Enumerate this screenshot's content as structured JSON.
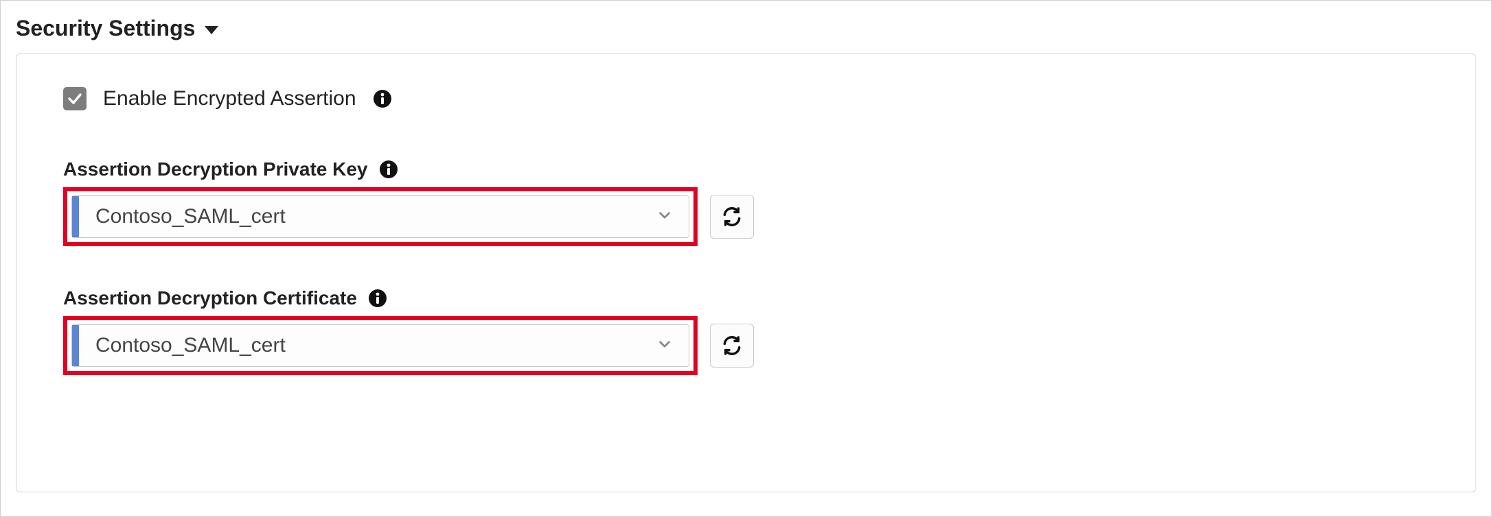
{
  "section": {
    "title": "Security Settings"
  },
  "checkbox": {
    "label": "Enable Encrypted Assertion",
    "checked": true
  },
  "fields": {
    "privateKey": {
      "label": "Assertion Decryption Private Key",
      "value": "Contoso_SAML_cert"
    },
    "certificate": {
      "label": "Assertion Decryption Certificate",
      "value": "Contoso_SAML_cert"
    }
  },
  "colors": {
    "highlight": "#e30021",
    "accent": "#5b86d6",
    "checkboxBg": "#7d7d7d"
  }
}
